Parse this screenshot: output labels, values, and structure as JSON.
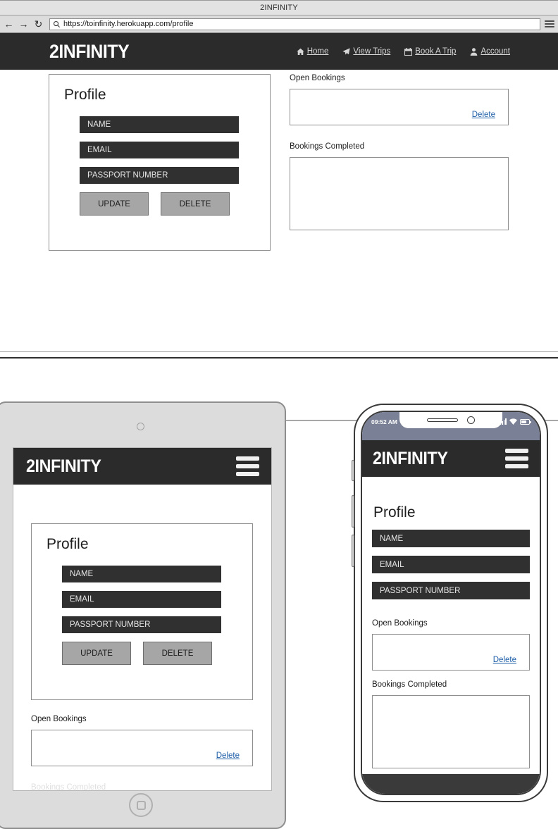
{
  "browser": {
    "window_title": "2INFINITY",
    "url": "https://toinfinity.herokuapp.com/profile",
    "back_icon": "←",
    "forward_icon": "→",
    "reload_icon": "↻",
    "search_icon": "⌕"
  },
  "site": {
    "logo": "2INFINITY",
    "nav": [
      {
        "label": "Home",
        "icon": "home-icon"
      },
      {
        "label": "View Trips",
        "icon": "paper-plane-icon"
      },
      {
        "label": "Book A Trip",
        "icon": "calendar-icon"
      },
      {
        "label": "Account",
        "icon": "user-icon"
      }
    ]
  },
  "profile_card": {
    "title": "Profile",
    "fields": [
      {
        "label": "NAME",
        "placeholder": "NAME"
      },
      {
        "label": "EMAIL",
        "placeholder": "EMAIL"
      },
      {
        "label": "PASSPORT NUMBER",
        "placeholder": "PASSPORT NUMBER"
      }
    ],
    "buttons": [
      {
        "label": "UPDATE"
      },
      {
        "label": "DELETE"
      }
    ]
  },
  "bookings": {
    "open_label": "Open Bookings",
    "open_delete_link": "Delete",
    "completed_label": "Bookings Completed"
  },
  "phone": {
    "status_time": "09:52 AM"
  },
  "colors": {
    "header_dark": "#2b2b2b",
    "field_dark": "#303030",
    "button_gray": "#a6a6a6",
    "link_blue": "#1f5fa8",
    "status_bar": "#7a8196"
  }
}
